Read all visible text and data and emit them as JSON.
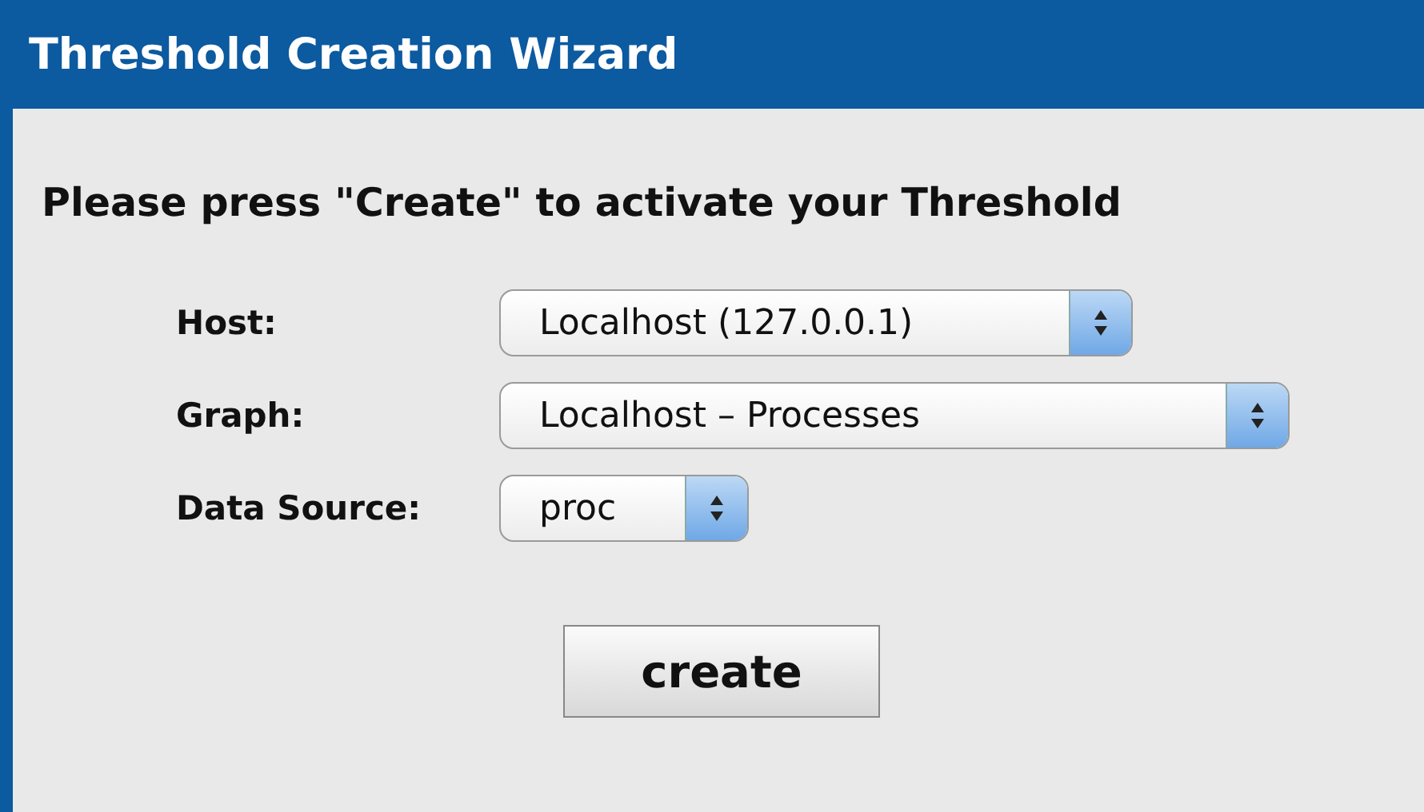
{
  "window": {
    "title": "Threshold Creation Wizard"
  },
  "instruction": "Please press \"Create\" to activate your Threshold",
  "fields": [
    {
      "label": "Host:",
      "value": "Localhost (127.0.0.1)"
    },
    {
      "label": "Graph:",
      "value": "Localhost – Processes"
    },
    {
      "label": "Data Source:",
      "value": "proc"
    }
  ],
  "buttons": [
    "create"
  ]
}
